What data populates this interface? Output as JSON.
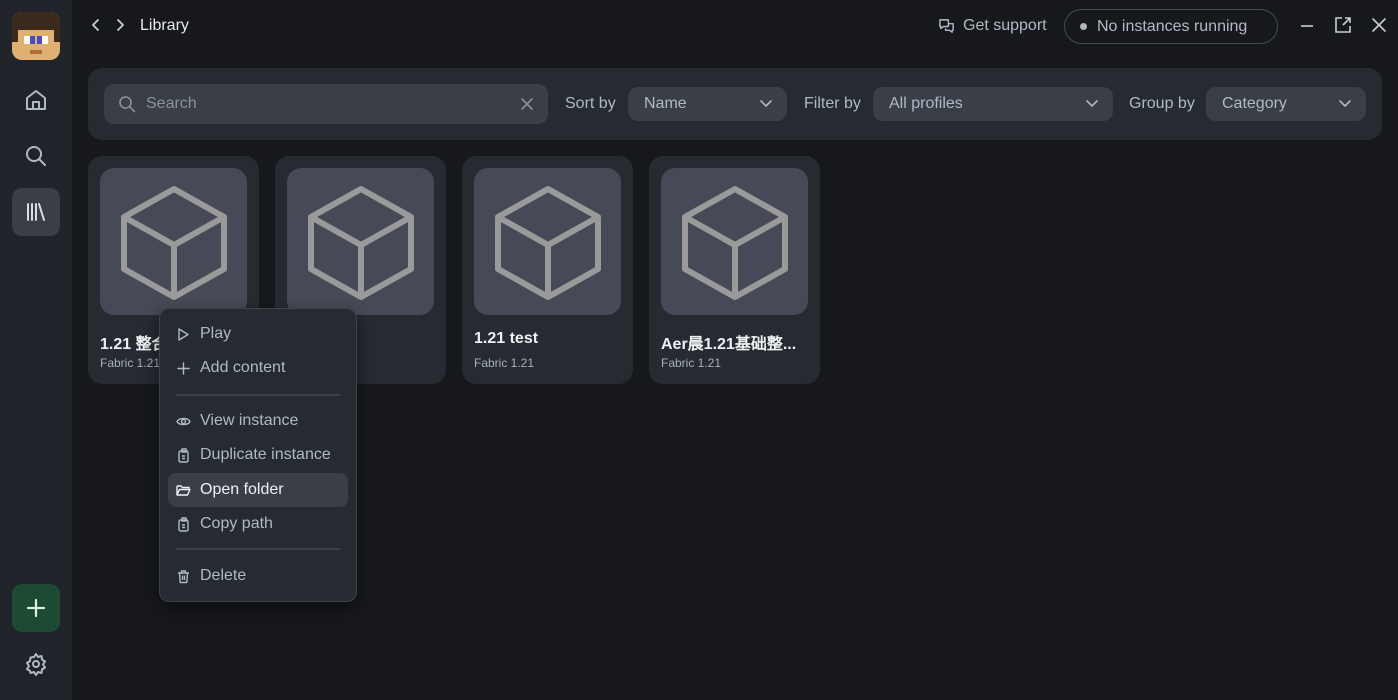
{
  "topbar": {
    "title": "Library",
    "support_label": "Get support",
    "instances_label": "No instances running"
  },
  "rail": {
    "items": [
      {
        "name": "home",
        "icon": "home-icon"
      },
      {
        "name": "search",
        "icon": "search-icon"
      },
      {
        "name": "library",
        "icon": "library-icon",
        "active": true
      }
    ],
    "add_icon": "plus-icon",
    "settings_icon": "gear-icon"
  },
  "filters": {
    "search_placeholder": "Search",
    "sort_label": "Sort by",
    "sort_value": "Name",
    "filter_label": "Filter by",
    "filter_value": "All profiles",
    "group_label": "Group by",
    "group_value": "Category"
  },
  "instances": [
    {
      "name": "1.21 整合",
      "version": "Fabric 1.21"
    },
    {
      "name": "",
      "version": ""
    },
    {
      "name": "1.21 test",
      "version": "Fabric 1.21"
    },
    {
      "name": "Aer晨1.21基础整...",
      "version": "Fabric 1.21"
    }
  ],
  "context_menu": {
    "items": [
      {
        "label": "Play",
        "icon": "play-icon"
      },
      {
        "label": "Add content",
        "icon": "plus-icon"
      },
      {
        "label": "View instance",
        "icon": "eye-icon"
      },
      {
        "label": "Duplicate instance",
        "icon": "copy-icon"
      },
      {
        "label": "Open folder",
        "icon": "folder-open-icon",
        "selected": true
      },
      {
        "label": "Copy path",
        "icon": "copy-icon"
      },
      {
        "label": "Delete",
        "icon": "trash-icon"
      }
    ]
  },
  "colors": {
    "background": "#16181c",
    "rail": "#202329",
    "card": "#262a31",
    "thumb": "#454a56",
    "add_button": "#1d4a32",
    "text": "#b0bac5"
  }
}
